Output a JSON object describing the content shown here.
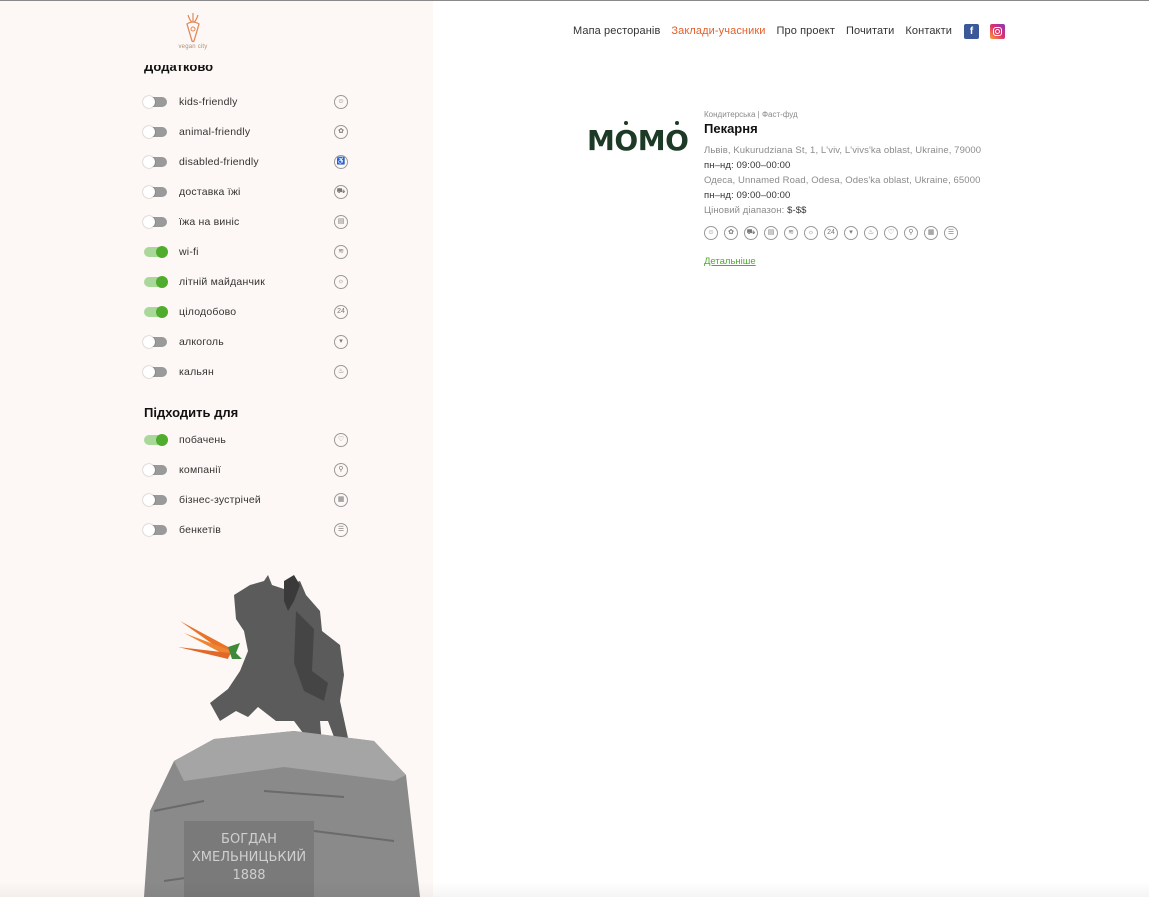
{
  "brand": {
    "logo_text": "vegan city"
  },
  "nav": {
    "items": [
      {
        "label": "Мапа ресторанів"
      },
      {
        "label": "Заклади-учасники"
      },
      {
        "label": "Про проект"
      },
      {
        "label": "Почитати"
      },
      {
        "label": "Контакти"
      }
    ],
    "active_index": 1,
    "facebook_label": "f"
  },
  "sidebar": {
    "section1_title": "Додатково",
    "extra_filters": [
      {
        "label": "kids-friendly",
        "on": false,
        "icon": "kids-icon",
        "glyph": "☺"
      },
      {
        "label": "animal-friendly",
        "on": false,
        "icon": "paw-icon",
        "glyph": "✿"
      },
      {
        "label": "disabled-friendly",
        "on": false,
        "icon": "wheelchair-icon",
        "glyph": "♿"
      },
      {
        "label": "доставка їжі",
        "on": false,
        "icon": "delivery-icon",
        "glyph": "⛟"
      },
      {
        "label": "їжа на виніс",
        "on": false,
        "icon": "takeaway-icon",
        "glyph": "▤"
      },
      {
        "label": "wi-fi",
        "on": true,
        "icon": "wifi-icon",
        "glyph": "≋"
      },
      {
        "label": "літній майданчик",
        "on": true,
        "icon": "sun-icon",
        "glyph": "☼"
      },
      {
        "label": "цілодобово",
        "on": true,
        "icon": "clock-24-icon",
        "glyph": "24"
      },
      {
        "label": "алкоголь",
        "on": false,
        "icon": "cocktail-icon",
        "glyph": "▾"
      },
      {
        "label": "кальян",
        "on": false,
        "icon": "hookah-icon",
        "glyph": "♨"
      }
    ],
    "section2_title": "Підходить для",
    "suitable_filters": [
      {
        "label": "побачень",
        "on": true,
        "icon": "heart-icon",
        "glyph": "♡"
      },
      {
        "label": "компанії",
        "on": false,
        "icon": "cutlery-icon",
        "glyph": "⚲"
      },
      {
        "label": "бізнес-зустрічей",
        "on": false,
        "icon": "meeting-icon",
        "glyph": "▦"
      },
      {
        "label": "бенкетів",
        "on": false,
        "icon": "banquet-icon",
        "glyph": "☰"
      }
    ],
    "statue_inscription": [
      "БОГДАН",
      "ХМЕЛЬНИЦЬКИЙ",
      "1888"
    ]
  },
  "restaurant": {
    "logo_text": "MOMO",
    "categories": "Кондитерська | Фаст-фуд",
    "name": "Пекарня",
    "address1": "Львів, Kukurudziana St, 1, L'viv, L'vivs'ka oblast, Ukraine, 79000",
    "hours1": "пн–нд: 09:00–00:00",
    "address2": "Одеса, Unnamed Road, Odesa, Odes'ka oblast, Ukraine, 65000",
    "hours2": "пн–нд: 09:00–00:00",
    "price_label": "Ціновий діапазон:",
    "price_value": "$-$$",
    "feature_icons": [
      {
        "icon": "kids-icon",
        "glyph": "☺"
      },
      {
        "icon": "paw-icon",
        "glyph": "✿"
      },
      {
        "icon": "delivery-icon",
        "glyph": "⛟"
      },
      {
        "icon": "takeaway-icon",
        "glyph": "▤"
      },
      {
        "icon": "wifi-icon",
        "glyph": "≋"
      },
      {
        "icon": "sun-icon",
        "glyph": "☼"
      },
      {
        "icon": "clock-24-icon",
        "glyph": "24"
      },
      {
        "icon": "cocktail-icon",
        "glyph": "▾"
      },
      {
        "icon": "hookah-icon",
        "glyph": "♨"
      },
      {
        "icon": "heart-icon",
        "glyph": "♡"
      },
      {
        "icon": "cutlery-icon",
        "glyph": "⚲"
      },
      {
        "icon": "meeting-icon",
        "glyph": "▦"
      },
      {
        "icon": "banquet-icon",
        "glyph": "☰"
      }
    ],
    "details_link": "Детальніше"
  },
  "colors": {
    "accent": "#e05f2c",
    "toggle_on": "#4fac2d",
    "sidebar_bg": "#fdf8f5",
    "momo_green": "#1c3a25"
  }
}
